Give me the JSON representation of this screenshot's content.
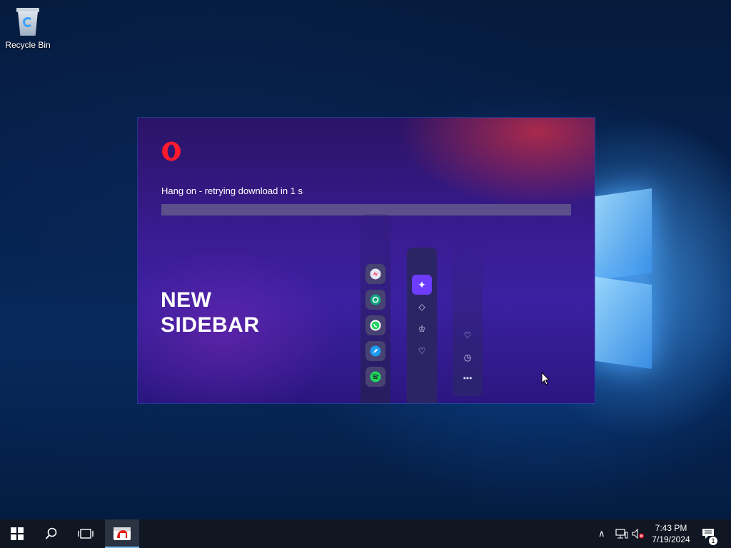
{
  "desktop": {
    "icons": [
      {
        "label": "Recycle Bin",
        "icon": "recycle-bin-icon"
      }
    ]
  },
  "installer": {
    "status": "Hang on - retrying download in 1 s",
    "progress_fraction": 0,
    "promo": {
      "line1": "NEW",
      "line2": "SIDEBAR"
    },
    "sidebar_apps": [
      "messenger-icon",
      "chatgpt-icon",
      "whatsapp-icon",
      "twitter-icon",
      "spotify-icon"
    ],
    "sidebar_nav": [
      "aria-icon",
      "diamond-icon",
      "crown-icon",
      "heart-chat-icon"
    ],
    "sidebar_extra": [
      "heart-icon",
      "clock-icon",
      "more-icon"
    ],
    "colors": {
      "accent": "#6d3cff",
      "opera_red": "#ff1b2d",
      "whatsapp": "#25d366",
      "twitter": "#1d9bf0",
      "spotify": "#1ed760",
      "chatgpt": "#10a37f"
    }
  },
  "taskbar": {
    "time": "7:43 PM",
    "date": "7/19/2024",
    "notification_count": "1"
  }
}
